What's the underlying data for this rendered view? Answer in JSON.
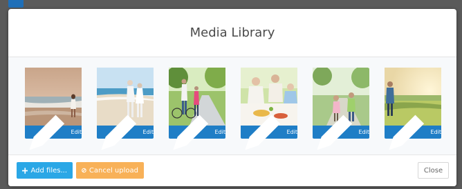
{
  "modal": {
    "title": "Media Library"
  },
  "gallery": {
    "items": [
      {
        "edit_label": "Edit",
        "image": "woman walking on beach"
      },
      {
        "edit_label": "Edit",
        "image": "elderly couple dancing on beach"
      },
      {
        "edit_label": "Edit",
        "image": "couple with bicycles in park"
      },
      {
        "edit_label": "Edit",
        "image": "family eating picnic"
      },
      {
        "edit_label": "Edit",
        "image": "family walking on path"
      },
      {
        "edit_label": "Edit",
        "image": "person in meadow at sunset"
      }
    ]
  },
  "footer": {
    "add_label": "Add files...",
    "cancel_label": "Cancel upload",
    "close_label": "Close"
  },
  "colors": {
    "edit_button": "#1f7ec6",
    "add_button": "#2aa7e6",
    "cancel_button": "#f8b158"
  },
  "icons": {
    "edit": "pencil-icon",
    "add": "plus-icon",
    "cancel": "ban-icon"
  }
}
